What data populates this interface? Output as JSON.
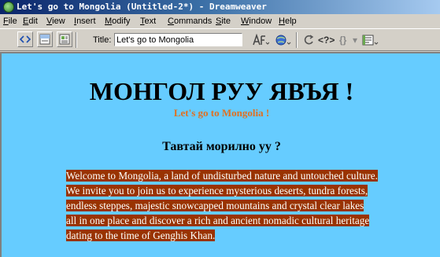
{
  "window": {
    "title": "Let's go to Mongolia (Untitled-2*) - Dreamweaver"
  },
  "menu": [
    {
      "ul": "F",
      "rest": "ile"
    },
    {
      "ul": "E",
      "rest": "dit"
    },
    {
      "ul": "V",
      "rest": "iew"
    },
    {
      "ul": "I",
      "rest": "nsert"
    },
    {
      "ul": "M",
      "rest": "odify"
    },
    {
      "ul": "T",
      "rest": "ext"
    },
    {
      "ul": "C",
      "rest": "ommands"
    },
    {
      "ul": "S",
      "rest": "ite"
    },
    {
      "ul": "W",
      "rest": "indow"
    },
    {
      "ul": "H",
      "rest": "elp"
    }
  ],
  "toolbar": {
    "title_label": "Title:",
    "title_value": "Let's go to Mongolia",
    "code_symbol": "<?>",
    "braces_symbol": "{}"
  },
  "document": {
    "heading": "МОНГОЛ РУУ ЯВЪЯ !",
    "subheading": "Let's go to Mongolia !",
    "question": "Тавтай морилно уу ?",
    "paragraph_lines": [
      "Welcome to Mongolia, a land of undisturbed nature and untouched culture.",
      "We invite you to join us to experience mysterious deserts, tundra forests,",
      "endless steppes, majestic snowcapped mountains and crystal clear lakes",
      "all in one place and discover a rich and ancient nomadic cultural heritage",
      "dating to the time of Genghis Khan."
    ]
  },
  "colors": {
    "document_bg": "#66ccff",
    "paragraph_bg": "#993300",
    "subheading": "#e07020",
    "titlebar": "#0a246a"
  }
}
